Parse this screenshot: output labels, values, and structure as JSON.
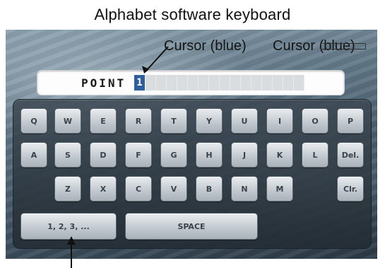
{
  "figure_title": "Alphabet software keyboard",
  "callout": {
    "label": "Cursor (blue)",
    "label_repeat": "Cursor (blue)"
  },
  "input": {
    "text": "POINT",
    "cursor_char": "1"
  },
  "keyboard": {
    "row1": [
      "Q",
      "W",
      "E",
      "R",
      "T",
      "Y",
      "U",
      "I",
      "O",
      "P"
    ],
    "row2": [
      "A",
      "S",
      "D",
      "F",
      "G",
      "H",
      "J",
      "K",
      "L",
      "Del."
    ],
    "row3": [
      "Z",
      "X",
      "C",
      "V",
      "B",
      "N",
      "M"
    ],
    "clear_label": "Clr.",
    "numeric_label": "1, 2, 3, ...",
    "space_label": "SPACE"
  },
  "colors": {
    "cursor": "#2f5f9a",
    "key_text": "#3b434a"
  }
}
